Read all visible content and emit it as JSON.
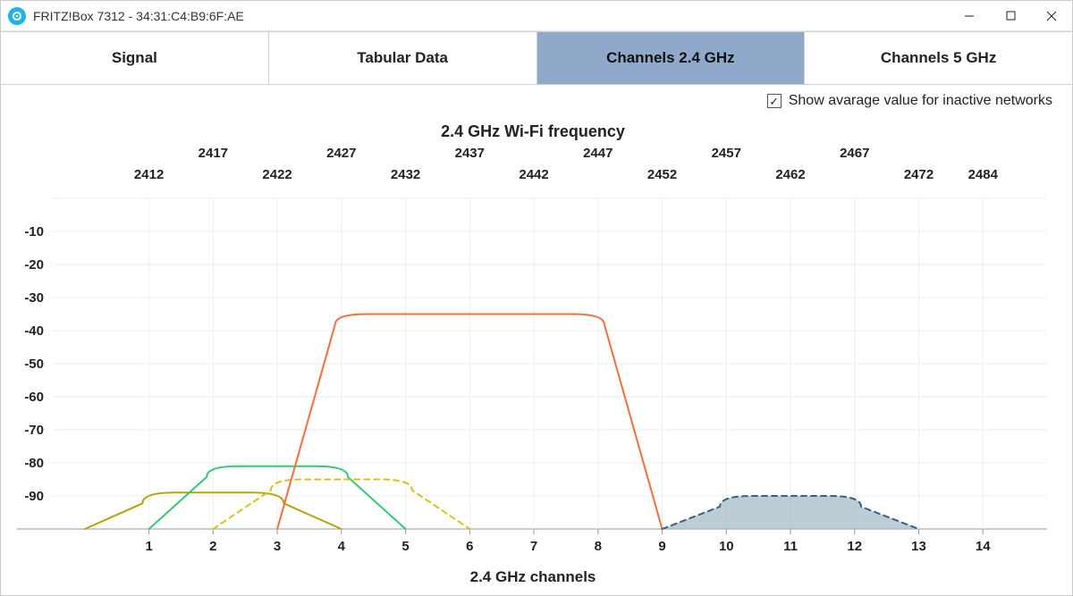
{
  "titlebar": {
    "app_name": "FRITZ!Box 7312",
    "mac": "34:31:C4:B9:6F:AE",
    "separator": " - "
  },
  "tabs": {
    "signal": "Signal",
    "tabular": "Tabular Data",
    "ch24": "Channels 2.4 GHz",
    "ch5": "Channels 5 GHz"
  },
  "checkbox": {
    "label": "Show avarage value for inactive networks",
    "checked": true
  },
  "chart": {
    "title": "2.4 GHz Wi-Fi frequency",
    "bottom_title": "2.4 GHz channels"
  },
  "chart_data": {
    "type": "line",
    "title": "2.4 GHz Wi-Fi frequency",
    "xlabel": "2.4 GHz channels",
    "ylabel": "",
    "ylim": [
      -100,
      0
    ],
    "y_ticks": [
      -10,
      -20,
      -30,
      -40,
      -50,
      -60,
      -70,
      -80,
      -90
    ],
    "x_channel_ticks": [
      1,
      2,
      3,
      4,
      5,
      6,
      7,
      8,
      9,
      10,
      11,
      12,
      13,
      14
    ],
    "x_freq_ticks_top1": [
      2417,
      2427,
      2437,
      2447,
      2457,
      2467
    ],
    "x_freq_ticks_top2": [
      2412,
      2422,
      2432,
      2442,
      2452,
      2462,
      2472,
      2484
    ],
    "series": [
      {
        "name": "olive-solid",
        "color": "#b8a20e",
        "style": "solid",
        "channel_start": 0,
        "channel_end": 4,
        "plateau_db": -89,
        "fill": false
      },
      {
        "name": "green-solid",
        "color": "#37c777",
        "style": "solid",
        "channel_start": 1,
        "channel_end": 5,
        "plateau_db": -81,
        "fill": false
      },
      {
        "name": "yellow-dash",
        "color": "#d4c41a",
        "style": "dashed",
        "channel_start": 2,
        "channel_end": 6,
        "plateau_db": -85,
        "fill": false
      },
      {
        "name": "orange-solid",
        "color": "#f07040",
        "style": "solid",
        "channel_start": 3,
        "channel_end": 9,
        "plateau_db": -35,
        "fill": false
      },
      {
        "name": "blue-dash",
        "color": "#3a5f82",
        "style": "dashed",
        "channel_start": 9,
        "channel_end": 13,
        "plateau_db": -90,
        "fill": true,
        "fill_color": "#9fb8c4"
      }
    ]
  }
}
